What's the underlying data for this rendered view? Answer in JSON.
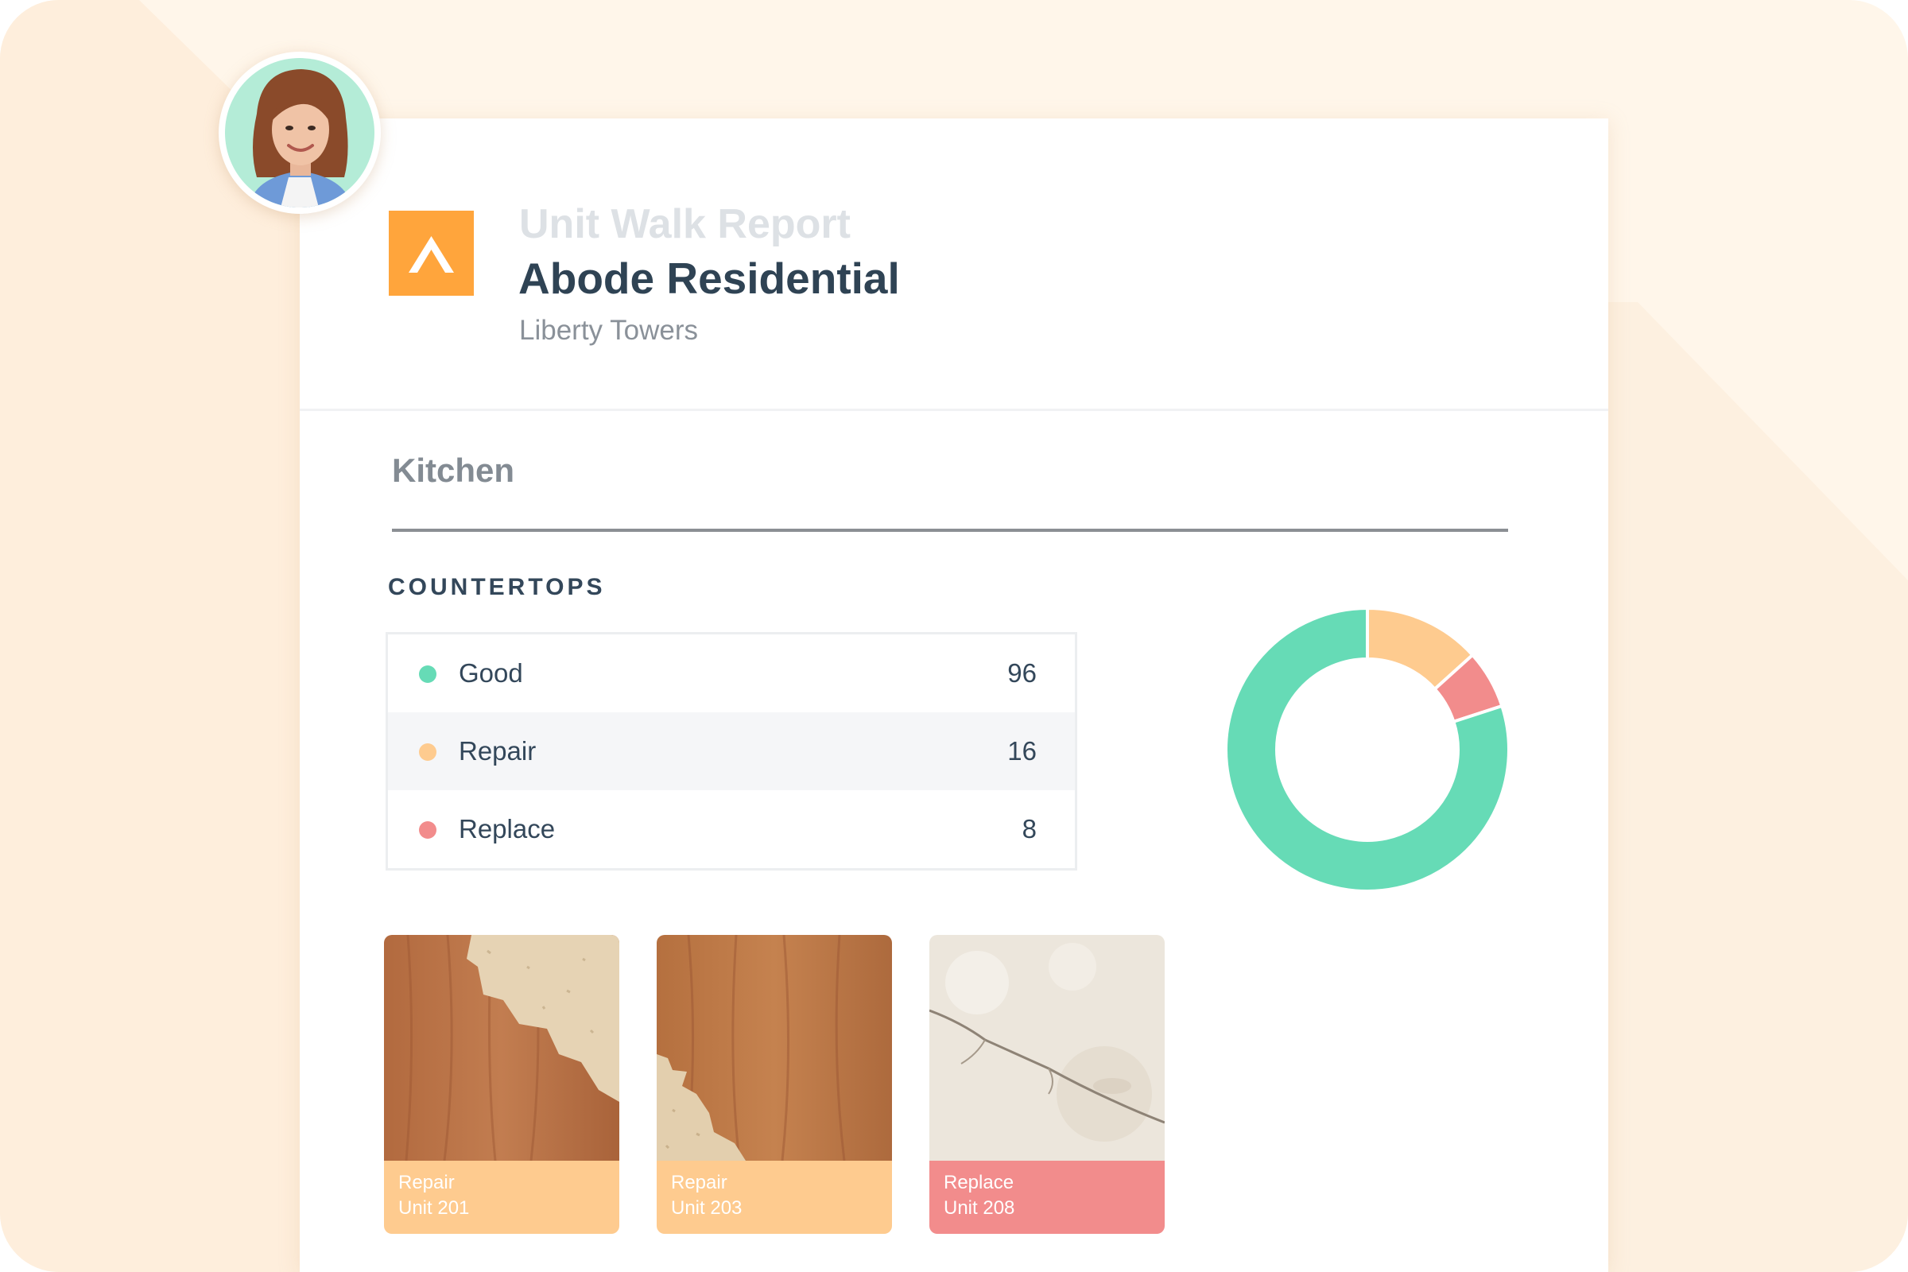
{
  "report": {
    "type": "Unit Walk Report",
    "company": "Abode Residential",
    "property": "Liberty Towers"
  },
  "section": {
    "title": "Kitchen",
    "category": "COUNTERTOPS"
  },
  "statuses": [
    {
      "label": "Good",
      "count": "96",
      "value": 96,
      "color": "#66dbb6"
    },
    {
      "label": "Repair",
      "count": "16",
      "value": 16,
      "color": "#fecb8f"
    },
    {
      "label": "Replace",
      "count": "8",
      "value": 8,
      "color": "#f28c8c"
    }
  ],
  "chart_data": {
    "type": "pie",
    "categories": [
      "Good",
      "Repair",
      "Replace"
    ],
    "values": [
      96,
      16,
      8
    ],
    "colors": [
      "#66dbb6",
      "#fecb8f",
      "#f28c8c"
    ]
  },
  "photos": [
    {
      "status": "Repair",
      "unit": "Unit 201",
      "color": "#fecb8f",
      "texture": "wood-chipped-right"
    },
    {
      "status": "Repair",
      "unit": "Unit 203",
      "color": "#fecb8f",
      "texture": "wood-chipped-left"
    },
    {
      "status": "Replace",
      "unit": "Unit 208",
      "color": "#f28c8c",
      "texture": "cracked-stone"
    }
  ],
  "icons": {
    "logo": "chevron-up-logo-icon",
    "avatar": "user-avatar"
  },
  "theme": {
    "accent": "#ffa53c",
    "heading": "#2f4354",
    "background": "#fff6ea"
  }
}
